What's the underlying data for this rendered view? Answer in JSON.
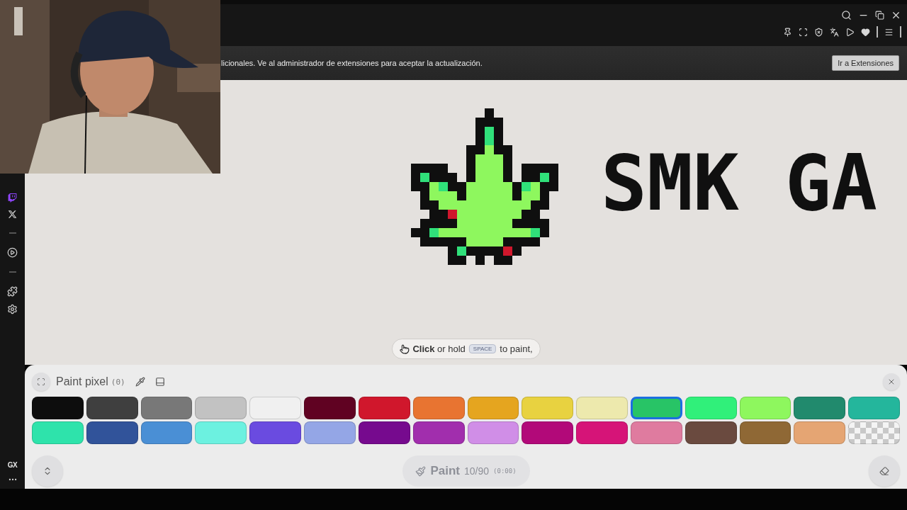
{
  "sidebar": {
    "logo": "GX"
  },
  "notification": {
    "message": "licionales. Ve al administrador de extensiones para aceptar la actualización.",
    "button": "Ir a Extensiones"
  },
  "canvas": {
    "lettering": "SMK GA"
  },
  "hint": {
    "before": "**Click** or hold",
    "key": "SPACE",
    "after": "to paint,"
  },
  "panel": {
    "title": "Paint pixel",
    "count": "(0)",
    "colors": [
      {
        "kind": "swatch",
        "color": "#0d0d0d",
        "selected": false
      },
      {
        "kind": "swatch",
        "color": "#3f3f3f",
        "selected": false
      },
      {
        "kind": "swatch",
        "color": "#787878",
        "selected": false
      },
      {
        "kind": "swatch",
        "color": "#c2c2c2",
        "selected": false
      },
      {
        "kind": "swatch",
        "color": "#f0f0f0",
        "selected": false
      },
      {
        "kind": "swatch",
        "color": "#600222",
        "selected": false
      },
      {
        "kind": "swatch",
        "color": "#d0172c",
        "selected": false
      },
      {
        "kind": "swatch",
        "color": "#e87431",
        "selected": false
      },
      {
        "kind": "swatch",
        "color": "#e5a51f",
        "selected": false
      },
      {
        "kind": "swatch",
        "color": "#e8d240",
        "selected": false
      },
      {
        "kind": "swatch",
        "color": "#ede9ad",
        "selected": false
      },
      {
        "kind": "swatch",
        "color": "#28c466",
        "selected": true
      },
      {
        "kind": "swatch",
        "color": "#30f07a",
        "selected": false
      },
      {
        "kind": "swatch",
        "color": "#8ef75e",
        "selected": false
      },
      {
        "kind": "swatch",
        "color": "#218a6d",
        "selected": false
      },
      {
        "kind": "swatch",
        "color": "#24b69c",
        "selected": false
      },
      {
        "kind": "swatch",
        "color": "#2ee3ab",
        "selected": false
      },
      {
        "kind": "swatch",
        "color": "#31539a",
        "selected": false
      },
      {
        "kind": "swatch",
        "color": "#4a8fd5",
        "selected": false
      },
      {
        "kind": "swatch",
        "color": "#6cf1e0",
        "selected": false
      },
      {
        "kind": "swatch",
        "color": "#6a4be0",
        "selected": false
      },
      {
        "kind": "swatch",
        "color": "#94a6e6",
        "selected": false
      },
      {
        "kind": "swatch",
        "color": "#760a8e",
        "selected": false
      },
      {
        "kind": "swatch",
        "color": "#a12ead",
        "selected": false
      },
      {
        "kind": "swatch",
        "color": "#d08ee7",
        "selected": false
      },
      {
        "kind": "swatch",
        "color": "#b20979",
        "selected": false
      },
      {
        "kind": "swatch",
        "color": "#d61478",
        "selected": false
      },
      {
        "kind": "swatch",
        "color": "#df7b9f",
        "selected": false
      },
      {
        "kind": "swatch",
        "color": "#6a4a3f",
        "selected": false
      },
      {
        "kind": "swatch",
        "color": "#8f6835",
        "selected": false
      },
      {
        "kind": "swatch",
        "color": "#e5a573",
        "selected": false
      },
      {
        "kind": "transparent",
        "selected": false
      }
    ],
    "paint_button": {
      "label": "Paint",
      "count": "10/90",
      "timer": "(0:00)",
      "disabled": true
    }
  }
}
